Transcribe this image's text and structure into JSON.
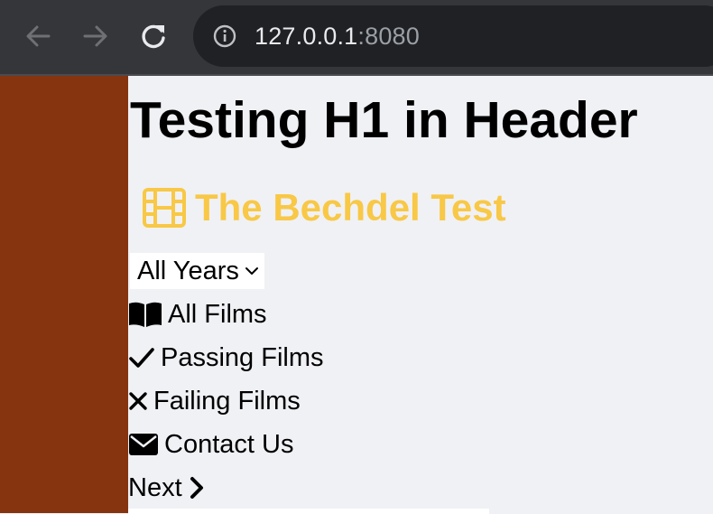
{
  "browser": {
    "url_host": "127.0.0.1",
    "url_port": ":8080"
  },
  "page": {
    "h1": "Testing H1 in Header",
    "site_title": "The Bechdel Test",
    "colors": {
      "sidebar": "#86340f",
      "site_title": "#f8c846",
      "background": "#f0f1f5"
    },
    "year_select": {
      "selected": "All Years"
    },
    "nav": {
      "all_films": "All Films",
      "passing_films": "Passing Films",
      "failing_films": "Failing Films",
      "contact_us": "Contact Us",
      "next": "Next"
    },
    "icons": {
      "back": "arrow-left-icon",
      "forward": "arrow-right-icon",
      "reload": "reload-icon",
      "info": "info-icon",
      "film": "film-icon",
      "book": "book-open-icon",
      "check": "check-icon",
      "times": "times-icon",
      "envelope": "envelope-icon",
      "chevron": "chevron-right-icon",
      "dropdown": "chevron-down-icon"
    }
  }
}
